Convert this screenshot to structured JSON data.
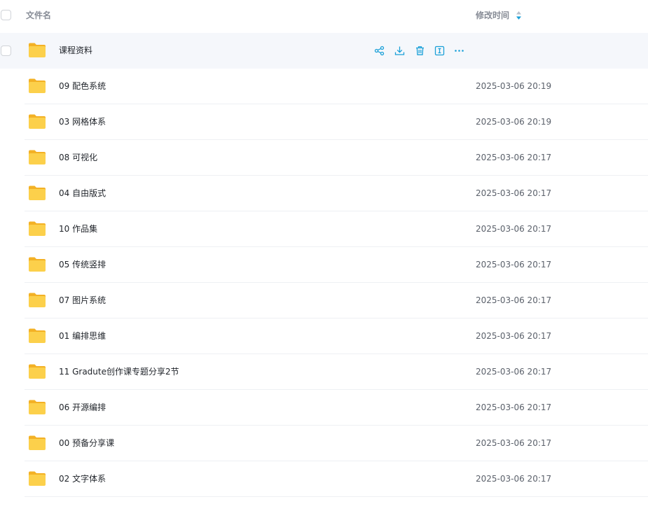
{
  "header": {
    "name_label": "文件名",
    "time_label": "修改时间",
    "sort_icon": "sort-desc-icon"
  },
  "colors": {
    "accent": "#1aa0d8",
    "folder": "#fbc02d",
    "hover_row": "#f5f7fb"
  },
  "actions": [
    "share-icon",
    "download-icon",
    "delete-icon",
    "rename-icon",
    "more-icon"
  ],
  "rows": [
    {
      "name": "课程资料",
      "time": ""
    },
    {
      "name": "09 配色系统",
      "time": "2025-03-06 20:19"
    },
    {
      "name": "03 网格体系",
      "time": "2025-03-06 20:19"
    },
    {
      "name": "08 可视化",
      "time": "2025-03-06 20:17"
    },
    {
      "name": "04 自由版式",
      "time": "2025-03-06 20:17"
    },
    {
      "name": "10 作品集",
      "time": "2025-03-06 20:17"
    },
    {
      "name": "05 传统竖排",
      "time": "2025-03-06 20:17"
    },
    {
      "name": "07 图片系统",
      "time": "2025-03-06 20:17"
    },
    {
      "name": "01 编排思维",
      "time": "2025-03-06 20:17"
    },
    {
      "name": "11 Gradute创作课专题分享2节",
      "time": "2025-03-06 20:17"
    },
    {
      "name": "06 开源编排",
      "time": "2025-03-06 20:17"
    },
    {
      "name": "00 预备分享课",
      "time": "2025-03-06 20:17"
    },
    {
      "name": "02 文字体系",
      "time": "2025-03-06 20:17"
    }
  ]
}
